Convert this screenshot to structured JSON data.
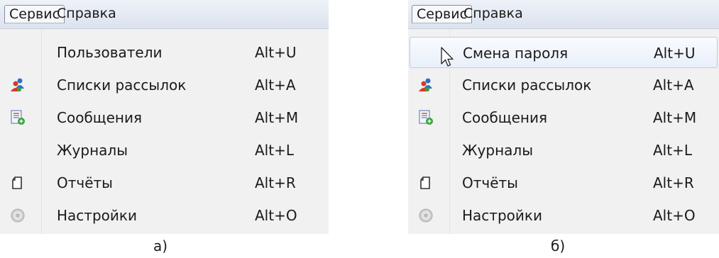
{
  "panels": [
    {
      "caption": "а)",
      "menubar": {
        "service": "Сервис",
        "help": "Справка"
      },
      "items": [
        {
          "label": "Пользователи",
          "shortcut": "Alt+U",
          "icon": "none"
        },
        {
          "label": "Списки рассылок",
          "shortcut": "Alt+A",
          "icon": "users-icon"
        },
        {
          "label": "Сообщения",
          "shortcut": "Alt+M",
          "icon": "messages-icon"
        },
        {
          "label": "Журналы",
          "shortcut": "Alt+L",
          "icon": "none"
        },
        {
          "label": "Отчёты",
          "shortcut": "Alt+R",
          "icon": "document-icon"
        },
        {
          "label": "Настройки",
          "shortcut": "Alt+O",
          "icon": "gear-icon"
        }
      ]
    },
    {
      "caption": "б)",
      "menubar": {
        "service": "Сервис",
        "help": "Справка"
      },
      "items": [
        {
          "label": "Смена пароля",
          "shortcut": "Alt+U",
          "icon": "none",
          "state": "hover"
        },
        {
          "label": "Списки рассылок",
          "shortcut": "Alt+A",
          "icon": "users-icon"
        },
        {
          "label": "Сообщения",
          "shortcut": "Alt+M",
          "icon": "messages-icon"
        },
        {
          "label": "Журналы",
          "shortcut": "Alt+L",
          "icon": "none"
        },
        {
          "label": "Отчёты",
          "shortcut": "Alt+R",
          "icon": "document-icon"
        },
        {
          "label": "Настройки",
          "shortcut": "Alt+O",
          "icon": "gear-icon"
        }
      ]
    }
  ],
  "colors": {
    "menubar": "#dbe3ef",
    "menu_bg": "#f1f1f1",
    "hover_border": "#b9cde8"
  }
}
